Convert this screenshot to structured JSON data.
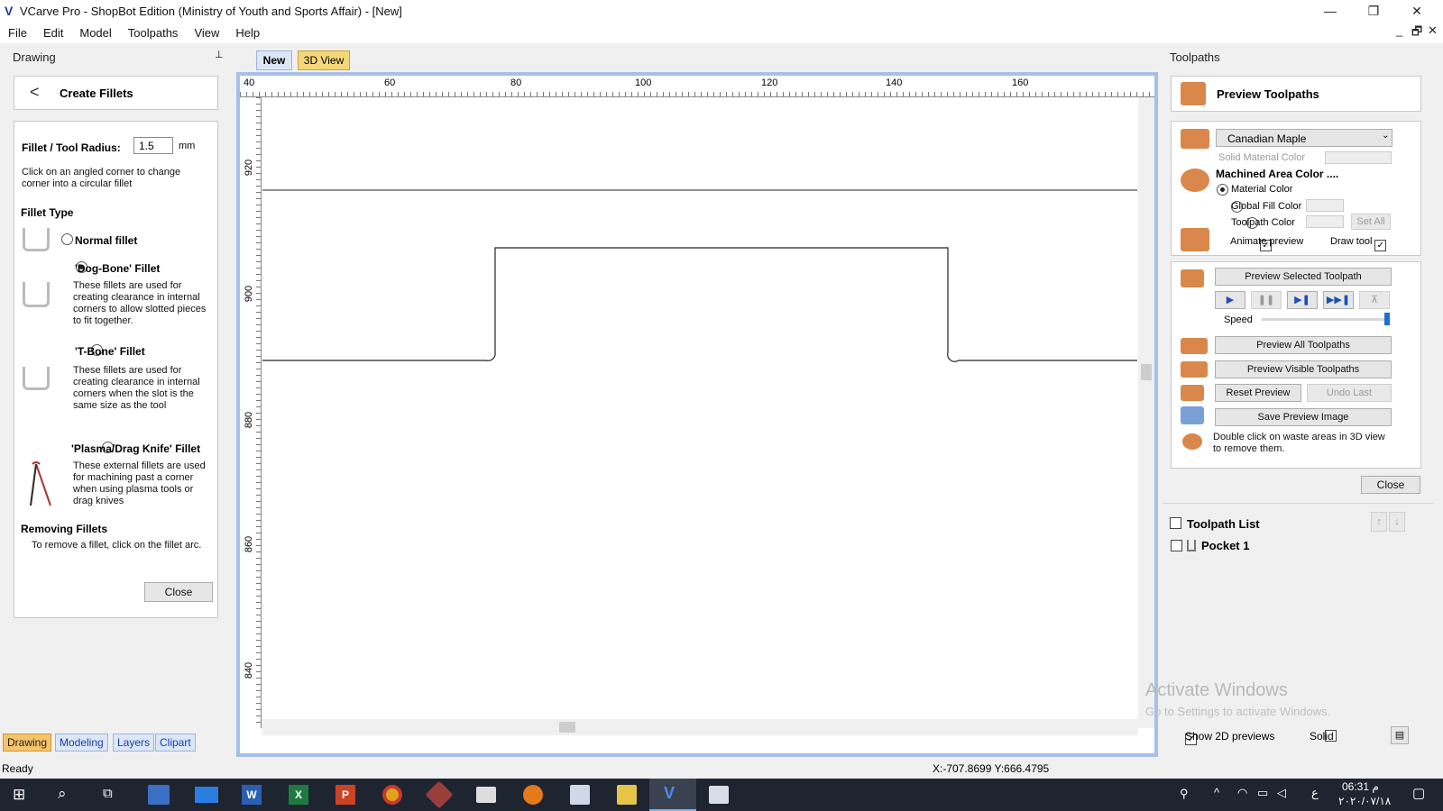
{
  "window": {
    "title": "VCarve Pro - ShopBot Edition (Ministry of Youth and Sports Affair) - [New]",
    "min": "—",
    "max": "❐",
    "close": "✕"
  },
  "menu": [
    "File",
    "Edit",
    "Model",
    "Toolpaths",
    "View",
    "Help"
  ],
  "mdi": {
    "min": "_",
    "restore": "🗗",
    "close": "✕"
  },
  "drawing_panel": {
    "header": "Drawing",
    "pin": "⊥",
    "title": "Create Fillets",
    "back": "<",
    "radius_label": "Fillet / Tool Radius:",
    "radius_value": "1.5",
    "radius_unit": "mm",
    "hint": "Click on an angled corner to change corner into a circular fillet",
    "fillet_type": "Fillet Type",
    "normal": "Normal fillet",
    "dogbone": "'Dog-Bone' Fillet",
    "dogbone_desc": "These fillets are used for creating clearance in internal corners to allow slotted pieces to fit together.",
    "tbone": "'T-Bone' Fillet",
    "tbone_desc": "These fillets are used for creating clearance in internal corners when the slot is the same size as the tool",
    "plasma": "'Plasma/Drag Knife' Fillet",
    "plasma_desc": "These external fillets are used for machining past a corner when using plasma tools or drag knives",
    "removing": "Removing Fillets",
    "removing_desc": "To remove a fillet, click on the fillet arc.",
    "close": "Close"
  },
  "bottom_tabs": [
    "Drawing",
    "Modeling",
    "Layers",
    "Clipart"
  ],
  "doc_tabs": [
    "New",
    "3D View"
  ],
  "ruler": {
    "h": [
      "40",
      "60",
      "80",
      "100",
      "120",
      "140",
      "160"
    ],
    "v": [
      "920",
      "900",
      "880",
      "860",
      "840"
    ]
  },
  "toolpaths_panel": {
    "header": "Toolpaths",
    "title": "Preview Toolpaths",
    "material": "Canadian Maple",
    "solid_material": "Solid Material Color",
    "machined": "Machined Area Color ....",
    "material_color": "Material Color",
    "global_fill": "Global Fill Color",
    "toolpath_color": "Toolpath Color",
    "set_all": "Set All",
    "animate": "Animate preview",
    "draw_tool": "Draw tool",
    "preview_selected": "Preview Selected Toolpath",
    "speed": "Speed",
    "preview_all": "Preview All Toolpaths",
    "preview_visible": "Preview Visible Toolpaths",
    "reset": "Reset Preview",
    "undo": "Undo Last",
    "save_image": "Save Preview Image",
    "hint": "Double click on waste areas in 3D view to remove them.",
    "close": "Close",
    "list_title": "Toolpath List",
    "items": [
      "Pocket 1"
    ],
    "show2d": "Show 2D previews",
    "solid": "Solid"
  },
  "watermark": {
    "line1": "Activate Windows",
    "line2": "Go to Settings to activate Windows."
  },
  "status": {
    "left": "Ready",
    "coords": "X:-707.8699 Y:666.4795"
  },
  "taskbar": {
    "time": "06:31 م",
    "date": "٢٠٢٠/٠٧/١٨",
    "lang": "ع"
  },
  "colors": {
    "accent": "#a7c0e6",
    "icon": "#d9874a",
    "taskbar": "#1e2430"
  }
}
